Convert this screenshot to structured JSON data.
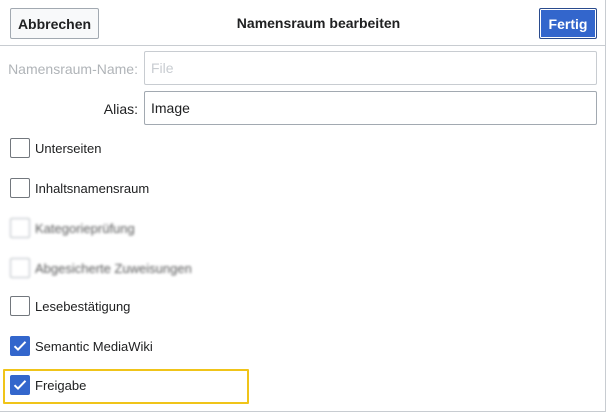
{
  "header": {
    "cancel_label": "Abbrechen",
    "title": "Namensraum bearbeiten",
    "done_label": "Fertig"
  },
  "fields": {
    "namespace_name": {
      "label": "Namensraum-Name:",
      "value": "File",
      "disabled": true
    },
    "alias": {
      "label": "Alias:",
      "value": "Image"
    }
  },
  "checkboxes": [
    {
      "label": "Unterseiten",
      "checked": false,
      "blurred": false
    },
    {
      "label": "Inhaltsnamensraum",
      "checked": false,
      "blurred": false
    },
    {
      "label": "Kategorieprüfung",
      "checked": false,
      "blurred": true
    },
    {
      "label": "Abgesicherte Zuweisungen",
      "checked": false,
      "blurred": true
    },
    {
      "label": "Lesebestätigung",
      "checked": false,
      "blurred": false
    },
    {
      "label": "Semantic MediaWiki",
      "checked": true,
      "blurred": false
    },
    {
      "label": "Freigabe",
      "checked": true,
      "blurred": false
    }
  ],
  "colors": {
    "accent": "#3366cc",
    "highlight": "#f0c419",
    "border": "#a2a9b1"
  },
  "icons": {
    "checkmark": "check-icon"
  }
}
